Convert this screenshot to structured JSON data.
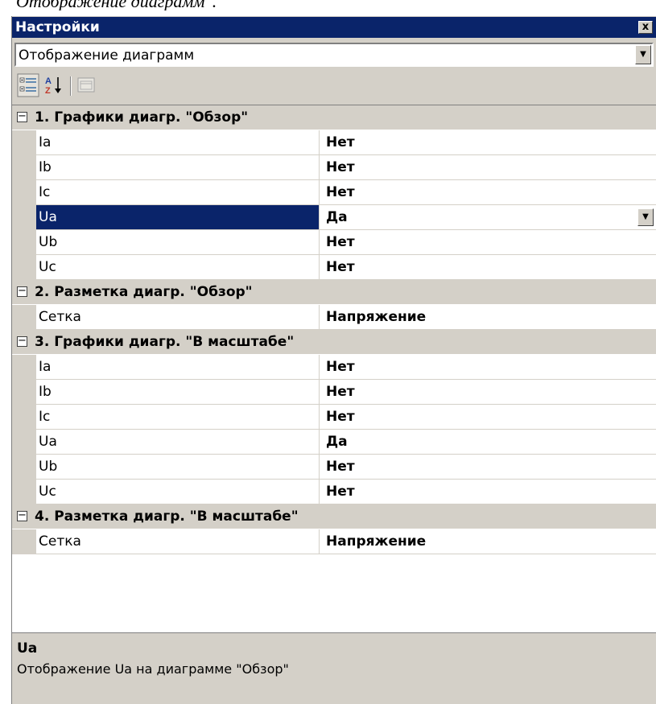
{
  "caption": "Отображение диаграмм\".",
  "window": {
    "title": "Настройки",
    "close_label": "x"
  },
  "object_select": {
    "value": "Отображение диаграмм"
  },
  "toolbar": {
    "buttons": [
      "categorized-icon",
      "alphabetical-icon",
      "property-pages-icon"
    ]
  },
  "grid": {
    "categories": [
      {
        "label": "1. Графики диагр. \"Обзор\"",
        "toggle": "−",
        "rows": [
          {
            "name": "Ia",
            "value": "Нет"
          },
          {
            "name": "Ib",
            "value": "Нет"
          },
          {
            "name": "Ic",
            "value": "Нет"
          },
          {
            "name": "Ua",
            "value": "Да",
            "selected": true
          },
          {
            "name": "Ub",
            "value": "Нет"
          },
          {
            "name": "Uc",
            "value": "Нет"
          }
        ]
      },
      {
        "label": "2. Разметка диагр. \"Обзор\"",
        "toggle": "−",
        "rows": [
          {
            "name": "Сетка",
            "value": "Напряжение"
          }
        ]
      },
      {
        "label": "3. Графики диагр. \"В масштабе\"",
        "toggle": "−",
        "rows": [
          {
            "name": "Ia",
            "value": "Нет"
          },
          {
            "name": "Ib",
            "value": "Нет"
          },
          {
            "name": "Ic",
            "value": "Нет"
          },
          {
            "name": "Ua",
            "value": "Да"
          },
          {
            "name": "Ub",
            "value": "Нет"
          },
          {
            "name": "Uc",
            "value": "Нет"
          }
        ]
      },
      {
        "label": "4. Разметка диагр. \"В масштабе\"",
        "toggle": "−",
        "rows": [
          {
            "name": "Сетка",
            "value": "Напряжение"
          }
        ]
      }
    ]
  },
  "help": {
    "title": "Ua",
    "description": "Отображение Ua на диаграмме \"Обзор\""
  },
  "colors": {
    "selection": "#0a246a",
    "face": "#d4d0c8"
  }
}
